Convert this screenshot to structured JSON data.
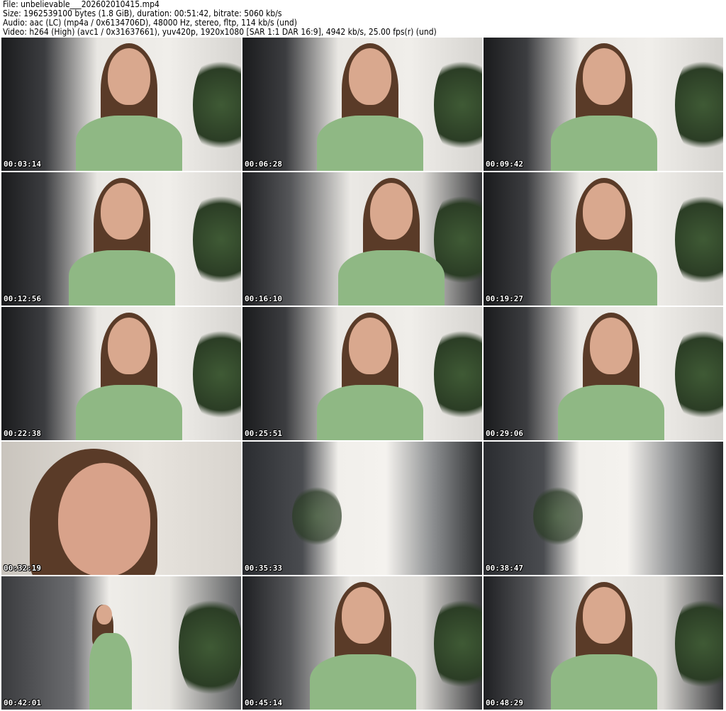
{
  "header": {
    "file": "File: unbelievable___202602010415.mp4",
    "size": "Size: 1962539100 bytes (1.8 GiB), duration: 00:51:42, bitrate: 5060 kb/s",
    "audio": "Audio: aac (LC) (mp4a / 0x6134706D), 48000 Hz, stereo, fltp, 114 kb/s (und)",
    "video": "Video: h264 (High) (avc1 / 0x31637661), yuv420p, 1920x1080 [SAR 1:1 DAR 16:9], 4942 kb/s, 25.00 fps(r) (und)"
  },
  "thumbnails": [
    {
      "timestamp": "00:03:14",
      "scene": "portrait"
    },
    {
      "timestamp": "00:06:28",
      "scene": "portrait"
    },
    {
      "timestamp": "00:09:42",
      "scene": "portrait"
    },
    {
      "timestamp": "00:12:56",
      "scene": "portrait"
    },
    {
      "timestamp": "00:16:10",
      "scene": "portrait-dark"
    },
    {
      "timestamp": "00:19:27",
      "scene": "portrait"
    },
    {
      "timestamp": "00:22:38",
      "scene": "portrait"
    },
    {
      "timestamp": "00:25:51",
      "scene": "portrait"
    },
    {
      "timestamp": "00:29:06",
      "scene": "portrait"
    },
    {
      "timestamp": "00:32:19",
      "scene": "closeup"
    },
    {
      "timestamp": "00:35:33",
      "scene": "blur"
    },
    {
      "timestamp": "00:38:47",
      "scene": "blur"
    },
    {
      "timestamp": "00:42:01",
      "scene": "wide"
    },
    {
      "timestamp": "00:45:14",
      "scene": "portrait-dark"
    },
    {
      "timestamp": "00:48:29",
      "scene": "portrait-dark"
    }
  ]
}
